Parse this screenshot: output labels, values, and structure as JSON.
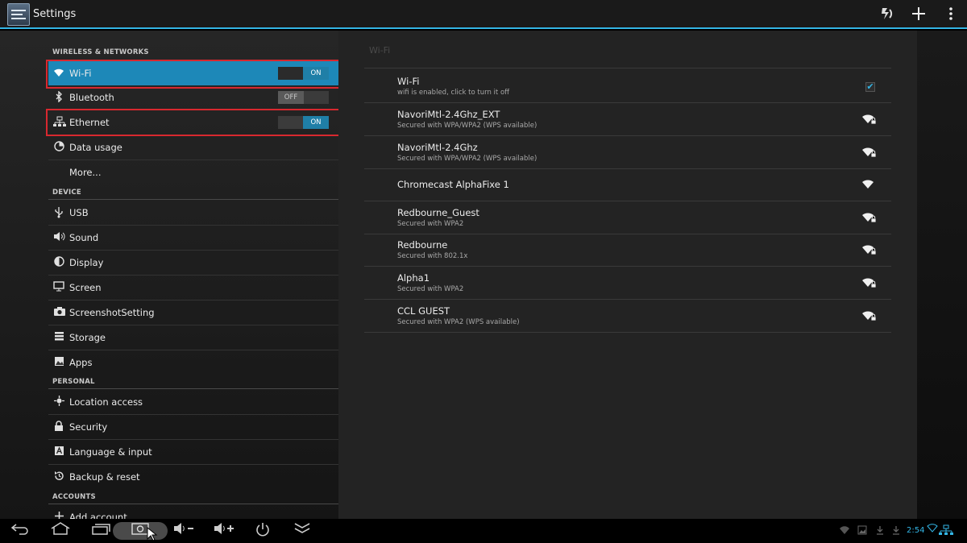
{
  "app": {
    "title": "Settings"
  },
  "sections": {
    "wireless": "WIRELESS & NETWORKS",
    "device": "DEVICE",
    "personal": "PERSONAL",
    "accounts": "ACCOUNTS"
  },
  "sidebar": {
    "wifi": {
      "label": "Wi-Fi",
      "toggle": "ON",
      "icon": "wifi-icon"
    },
    "bluetooth": {
      "label": "Bluetooth",
      "toggle": "OFF",
      "icon": "bluetooth-icon"
    },
    "ethernet": {
      "label": "Ethernet",
      "toggle": "ON",
      "icon": "ethernet-icon"
    },
    "data_usage": {
      "label": "Data usage",
      "icon": "data-usage-icon"
    },
    "more": {
      "label": "More..."
    },
    "usb": {
      "label": "USB",
      "icon": "usb-icon"
    },
    "sound": {
      "label": "Sound",
      "icon": "speaker-icon"
    },
    "display": {
      "label": "Display",
      "icon": "display-icon"
    },
    "screen": {
      "label": "Screen",
      "icon": "monitor-icon"
    },
    "screenshot": {
      "label": "ScreenshotSetting",
      "icon": "camera-icon"
    },
    "storage": {
      "label": "Storage",
      "icon": "storage-icon"
    },
    "apps": {
      "label": "Apps",
      "icon": "apps-icon"
    },
    "location": {
      "label": "Location access",
      "icon": "location-icon"
    },
    "security": {
      "label": "Security",
      "icon": "lock-icon"
    },
    "language": {
      "label": "Language & input",
      "icon": "language-icon"
    },
    "backup": {
      "label": "Backup & reset",
      "icon": "backup-icon"
    },
    "add_account": {
      "label": "Add account",
      "icon": "plus-icon"
    }
  },
  "wifi_panel": {
    "title": "Wi-Fi",
    "master": {
      "title": "Wi-Fi",
      "subtitle": "wifi is enabled, click to turn it off",
      "checked": true
    },
    "networks": [
      {
        "ssid": "NavoriMtl-2.4Ghz_EXT",
        "security": "Secured with WPA/WPA2 (WPS available)",
        "secured": true
      },
      {
        "ssid": "NavoriMtl-2.4Ghz",
        "security": "Secured with WPA/WPA2 (WPS available)",
        "secured": true
      },
      {
        "ssid": "Chromecast AlphaFixe 1",
        "security": "",
        "secured": false
      },
      {
        "ssid": "Redbourne_Guest",
        "security": "Secured with WPA2",
        "secured": true
      },
      {
        "ssid": "Redbourne",
        "security": "Secured with 802.1x",
        "secured": true
      },
      {
        "ssid": "Alpha1",
        "security": "Secured with WPA2",
        "secured": true
      },
      {
        "ssid": "CCL GUEST",
        "security": "Secured with WPA2 (WPS available)",
        "secured": true
      }
    ]
  },
  "status": {
    "clock": "2:54"
  },
  "colors": {
    "accent": "#33b5e5",
    "selected": "#1d88b8",
    "highlight": "#d8282f"
  }
}
